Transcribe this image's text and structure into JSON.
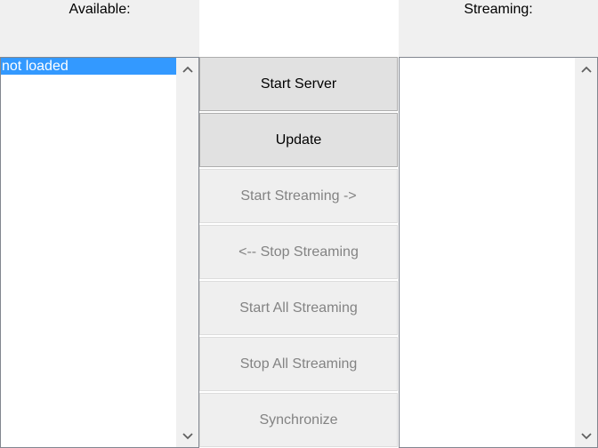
{
  "available": {
    "label": "Available:",
    "items": [
      {
        "text": "not loaded",
        "selected": true
      }
    ]
  },
  "streaming": {
    "label": "Streaming:",
    "items": []
  },
  "buttons": {
    "start_server": "Start Server",
    "update": "Update",
    "start_streaming": "Start Streaming ->",
    "stop_streaming": "<-- Stop Streaming",
    "start_all_streaming": "Start All Streaming",
    "stop_all_streaming": "Stop All Streaming",
    "synchronize": "Synchronize"
  },
  "colors": {
    "selection": "#3399ff",
    "panel_background": "#f0f0f0",
    "button_enabled": "#e1e1e1",
    "button_disabled_text": "#838383"
  }
}
